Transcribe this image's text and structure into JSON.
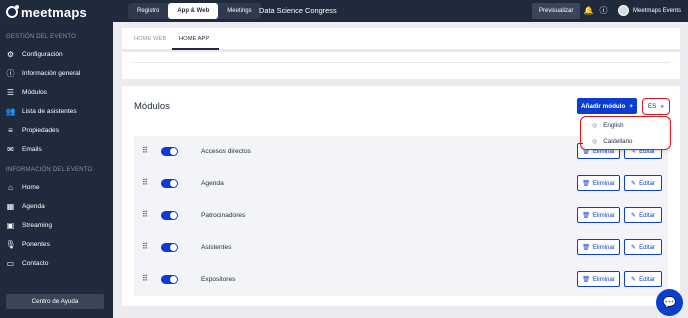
{
  "app": {
    "logo_text": "meetmaps",
    "event_title": "Data Science Congress"
  },
  "top_tabs": [
    {
      "label": "Registro",
      "active": false
    },
    {
      "label": "App & Web",
      "active": true
    },
    {
      "label": "Meetings",
      "active": false
    }
  ],
  "topbar": {
    "preview_label": "Previsualizar",
    "user_name": "Meetmaps Events"
  },
  "sidebar": {
    "section1": "GESTIÓN DEL EVENTO",
    "section1_items": [
      {
        "label": "Configuración",
        "icon": "gear-icon"
      },
      {
        "label": "Información general",
        "icon": "info-icon"
      },
      {
        "label": "Módulos",
        "icon": "list-icon"
      },
      {
        "label": "Lista de asistentes",
        "icon": "users-icon"
      },
      {
        "label": "Propiedades",
        "icon": "properties-icon"
      },
      {
        "label": "Emails",
        "icon": "mail-icon"
      }
    ],
    "section2": "INFORMACIÓN DEL EVENTO",
    "section2_items": [
      {
        "label": "Home",
        "icon": "home-icon"
      },
      {
        "label": "Agenda",
        "icon": "calendar-icon"
      },
      {
        "label": "Streaming",
        "icon": "streaming-icon"
      },
      {
        "label": "Ponentes",
        "icon": "microphone-icon"
      },
      {
        "label": "Contacto",
        "icon": "chat-icon"
      }
    ],
    "help_label": "Centro de Ayuda"
  },
  "subtabs": [
    {
      "label": "HOME WEB",
      "active": false
    },
    {
      "label": "HOME APP",
      "active": true
    }
  ],
  "modules": {
    "title": "Módulos",
    "add_label": "Añadir módulo",
    "language_code": "ES",
    "delete_label": "Eliminar",
    "edit_label": "Editar",
    "rows": [
      {
        "name": "Accesos directos",
        "enabled": true
      },
      {
        "name": "Agenda",
        "enabled": true
      },
      {
        "name": "Patrocinadores",
        "enabled": true
      },
      {
        "name": "Asistentes",
        "enabled": true
      },
      {
        "name": "Expositores",
        "enabled": true
      }
    ]
  },
  "language_dropdown": {
    "options": [
      "English",
      "Castellano"
    ]
  },
  "colors": {
    "sidebar": "#1f2a3d",
    "accent": "#0b3ecf",
    "highlight": "#e0141c"
  }
}
